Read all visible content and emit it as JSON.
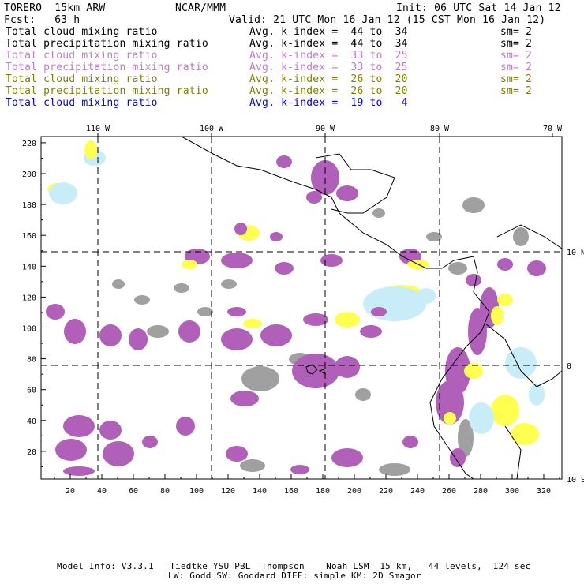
{
  "header": {
    "model": "TORERO  15km ARW",
    "org": "NCAR/MMM",
    "init": "Init: 06 UTC Sat 14 Jan 12",
    "fcst": "Fcst:   63 h",
    "valid": "Valid: 21 UTC Mon 16 Jan 12 (15 CST Mon 16 Jan 12)"
  },
  "legend": [
    {
      "field": "Total cloud mixing ratio",
      "range": "Avg. k-index =  44 to  34",
      "sm": "sm= 2",
      "color": "#000000"
    },
    {
      "field": "Total precipitation mixing ratio",
      "range": "Avg. k-index =  44 to  34",
      "sm": "sm= 2",
      "color": "#000000"
    },
    {
      "field": "Total cloud mixing ratio",
      "range": "Avg. k-index =  33 to  25",
      "sm": "sm= 2",
      "color": "#c07cc8"
    },
    {
      "field": "Total precipitation mixing ratio",
      "range": "Avg. k-index =  33 to  25",
      "sm": "sm= 2",
      "color": "#c07cc8"
    },
    {
      "field": "Total cloud mixing ratio",
      "range": "Avg. k-index =  26 to  20",
      "sm": "sm= 2",
      "color": "#808000"
    },
    {
      "field": "Total precipitation mixing ratio",
      "range": "Avg. k-index =  26 to  20",
      "sm": "sm= 2",
      "color": "#808000"
    },
    {
      "field": "Total cloud mixing ratio",
      "range": "Avg. k-index =  19 to   4",
      "sm": "",
      "color": "#0000ff"
    }
  ],
  "map": {
    "lon_labels": [
      "110 W",
      "100 W",
      "90 W",
      "80 W",
      "70 W"
    ],
    "lat_labels": [
      "10 N",
      "0",
      "10 S"
    ],
    "x_ticks": [
      "20",
      "40",
      "60",
      "80",
      "100",
      "120",
      "140",
      "160",
      "180",
      "200",
      "220",
      "240",
      "260",
      "280",
      "300",
      "320"
    ],
    "y_ticks": [
      "20",
      "40",
      "60",
      "80",
      "100",
      "120",
      "140",
      "160",
      "180",
      "200",
      "220"
    ],
    "colors": {
      "gray": "#a0a0a0",
      "purple": "#b060b8",
      "yellow": "#ffff50",
      "lightblue": "#c8ecf8"
    }
  },
  "footer": {
    "line1": "Model Info: V3.3.1   Tiedtke YSU PBL  Thompson    Noah LSM  15 km,   44 levels,  124 sec",
    "line2": "LW: Godd SW: Goddard DIFF: simple KM: 2D Smagor"
  }
}
